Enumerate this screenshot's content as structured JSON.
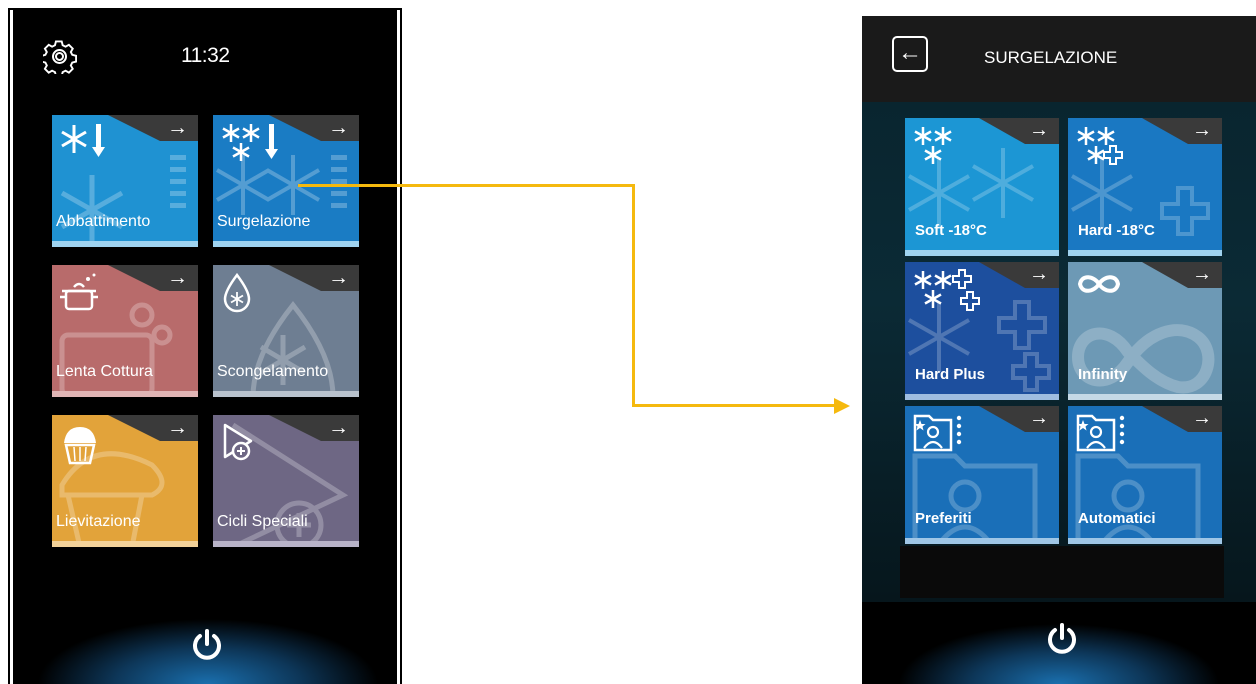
{
  "left_screen": {
    "time": "11:32",
    "tiles": [
      {
        "label": "Abbattimento",
        "color": "#1f92d2",
        "bar": "#9fd3f0",
        "icon": "snowflake-thermo-icon"
      },
      {
        "label": "Surgelazione",
        "color": "#1a7cc4",
        "bar": "#9fd3f0",
        "icon": "double-snowflake-thermo-icon"
      },
      {
        "label": "Lenta Cottura",
        "color": "#b86b6b",
        "bar": "#e0b5b5",
        "icon": "pot-icon"
      },
      {
        "label": "Scongelamento",
        "color": "#6e7e92",
        "bar": "#b9c2cd",
        "icon": "drop-snowflake-icon"
      },
      {
        "label": "Lievitazione",
        "color": "#e2a33a",
        "bar": "#f3d29a",
        "icon": "muffin-icon"
      },
      {
        "label": "Cicli Speciali",
        "color": "#6e6784",
        "bar": "#b8b3c8",
        "icon": "play-plus-icon"
      }
    ],
    "arrow": "→"
  },
  "connector_color": "#f5b90e",
  "right_screen": {
    "title": "SURGELAZIONE",
    "back_arrow": "←",
    "tiles": [
      {
        "label": "Soft -18°C",
        "color": "#1c96d4",
        "bar": "#9fd3f0",
        "icon": "snowflakes-icon"
      },
      {
        "label": "Hard -18°C",
        "color": "#1a78c2",
        "bar": "#9fd3f0",
        "icon": "snowflakes-plus-icon"
      },
      {
        "label": "Hard Plus",
        "color": "#1d4f9e",
        "bar": "#9fbde0",
        "icon": "snowflakes-double-plus-icon"
      },
      {
        "label": "Infinity",
        "color": "#6d99b5",
        "bar": "#c5d9e6",
        "icon": "infinity-icon"
      },
      {
        "label": "Preferiti",
        "color": "#1a6fb8",
        "bar": "#9fc6e6",
        "icon": "favorites-folder-icon"
      },
      {
        "label": "Automatici",
        "color": "#1a6fb8",
        "bar": "#9fc6e6",
        "icon": "auto-folder-icon"
      }
    ],
    "arrow": "→"
  }
}
